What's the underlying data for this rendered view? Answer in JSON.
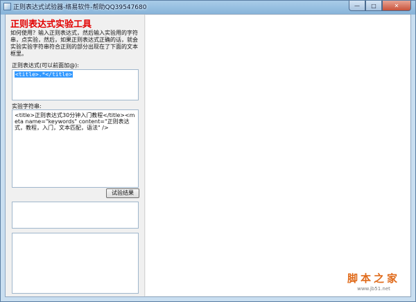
{
  "window": {
    "title": "正则表达式试验器-络易软件-帮助QQ39547680",
    "minimize_glyph": "—",
    "maximize_glyph": "□",
    "close_glyph": "✕"
  },
  "app": {
    "title": "正则表达式实验工具",
    "instructions": "如何使用？输入正则表达式，然后输入实验用的字符串，点实验，然后，如果正则表达式正确的话，就会实验实验字符串符合正则的部分出现在了下面的文本框里。"
  },
  "regex": {
    "label": "正则表达式(可以前面加@):",
    "value": "<title>.*</title>"
  },
  "test_string": {
    "label": "实验字符串:",
    "value": "<title>正则表达式30分钟入门教程</title><meta name=\"keywords\" content=\"正则表达式，教程，入门，文本匹配，语法\" />"
  },
  "buttons": {
    "test_label": "试验结果"
  },
  "watermark": {
    "main": "脚本之家",
    "url": "www.jb51.net"
  }
}
